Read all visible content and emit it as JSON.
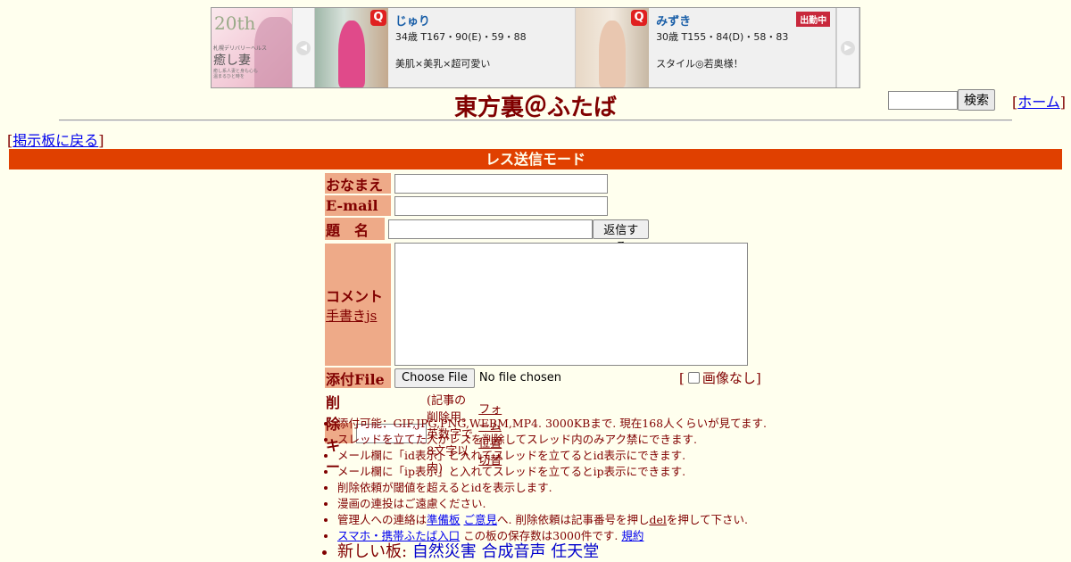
{
  "banner": {
    "side_ad": {
      "big_text": "20th",
      "tag_text": "札幌デリバリーヘルス",
      "name_text": "癒し妻",
      "sub_text": "癒し系人妻と身も心も温まるひと時を"
    },
    "prev_arrow": "◀",
    "next_arrow": "▶",
    "cards": [
      {
        "q_logo": "Q",
        "name": "じゅり",
        "stats": "34歳 T167・90(E)・59・88",
        "catch": "美肌×美乳×超可愛い"
      },
      {
        "q_logo": "Q",
        "name": "みずき",
        "stats": "30歳 T155・84(D)・58・83",
        "catch": "スタイル◎若奥様！",
        "badge": "出勤中"
      }
    ]
  },
  "header": {
    "title": "東方裏＠ふたば",
    "search_button": "検索",
    "home_prefix": "[",
    "home_link": "ホーム",
    "home_suffix": "]"
  },
  "nav": {
    "back_prefix": "[",
    "back_link": "掲示板に戻る",
    "back_suffix": "]"
  },
  "mode_bar": "レス送信モード",
  "form": {
    "name_label": "おなまえ",
    "email_label": "E-mail",
    "subject_label": "題　名",
    "submit_button": "返信する",
    "comment_label": "コメント",
    "handwrite_link": "手書きjs",
    "file_label": "添付File",
    "file_button": "Choose File",
    "file_status": "No file chosen",
    "no_image_prefix": "[",
    "no_image_label": "画像なし",
    "no_image_suffix": "]",
    "delkey_label": "削除キー",
    "delkey_note": "(記事の削除用。英数字で8文字以内)",
    "form_pos_link": "フォーム位置切替"
  },
  "notes": [
    "添付可能：GIF,JPG,PNG,WEBM,MP4. 3000KBまで. 現在168人くらいが見てます.",
    "スレッドを立てた人がレスを削除してスレッド内のみアク禁にできます.",
    "メール欄に「id表示」と入れてスレッドを立てるとid表示にできます.",
    "メール欄に「ip表示」と入れてスレッドを立てるとip表示にできます.",
    "削除依頼が閾値を超えるとidを表示します.",
    "漫画の連投はご遠慮ください."
  ],
  "contact_note": {
    "prefix": "管理人への連絡は",
    "link1": "準備板",
    "link2": "ご意見",
    "middle": "へ. 削除依頼は記事番号を押し",
    "del_link": "del",
    "suffix": "を押して下さい."
  },
  "mobile_note": {
    "link": "スマホ・携帯ふたば入口",
    "text": " この板の保存数は3000件です.",
    "rules_link": "規約"
  },
  "new_boards": {
    "label": "新しい板:",
    "boards": [
      "自然災害",
      "合成音声",
      "任天堂"
    ]
  }
}
